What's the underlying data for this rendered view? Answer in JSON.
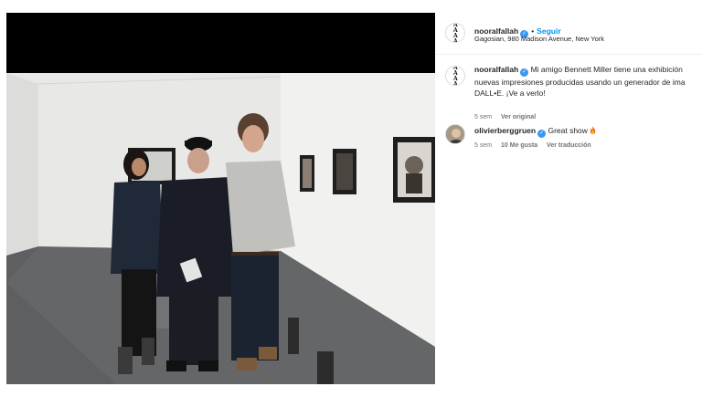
{
  "post": {
    "author": "nooralfallah",
    "follow_label": "Seguir",
    "separator": "•",
    "location": "Gagosian, 980 Madison Avenue, New York",
    "avatar_icon": "logo-icon",
    "avatar_logo_text": "AAAA"
  },
  "caption": {
    "username": "nooralfallah",
    "text_line1": "Mi amigo Bennett Miller tiene una exhibición",
    "text_line2": "nuevas impresiones producidas usando un generador de ima",
    "text_line3": "DALL•E. ¡Ve a verlo!",
    "time": "5 sem",
    "see_translation": "Ver original"
  },
  "comments": [
    {
      "username": "olivierberggruen",
      "text": "Great show",
      "emoji": "fire-icon",
      "time": "5 sem",
      "likes": "10 Me gusta",
      "translate": "Ver traducción"
    }
  ],
  "colors": {
    "accent": "#0095f6",
    "verified": "#3897f0",
    "muted": "#737373",
    "text": "#262626"
  }
}
